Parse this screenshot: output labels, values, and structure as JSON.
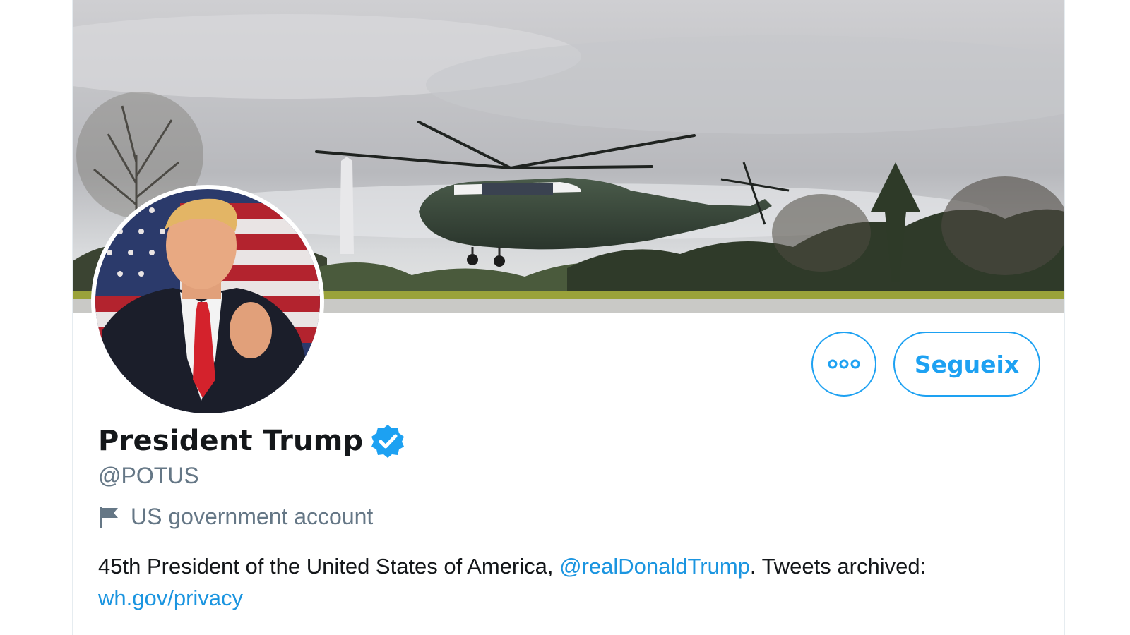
{
  "colors": {
    "accent": "#1da1f2",
    "link": "#1b95e0",
    "text_primary": "#14171a",
    "text_secondary": "#657786",
    "verified_badge": "#1da1f2"
  },
  "banner": {
    "description_icon": "banner-helicopter-photo"
  },
  "avatar": {
    "icon": "avatar-photo"
  },
  "actions": {
    "more_icon": "more-options-icon",
    "follow_label": "Segueix"
  },
  "profile": {
    "display_name": "President Trump",
    "verified_icon": "verified-badge-icon",
    "handle": "@POTUS",
    "account_label_icon": "flag-icon",
    "account_label": "US government account"
  },
  "bio": {
    "text_before": "45th President of the United States of America, ",
    "mention": "@realDonaldTrump",
    "text_after": ". Tweets archived: ",
    "link": "wh.gov/privacy"
  }
}
